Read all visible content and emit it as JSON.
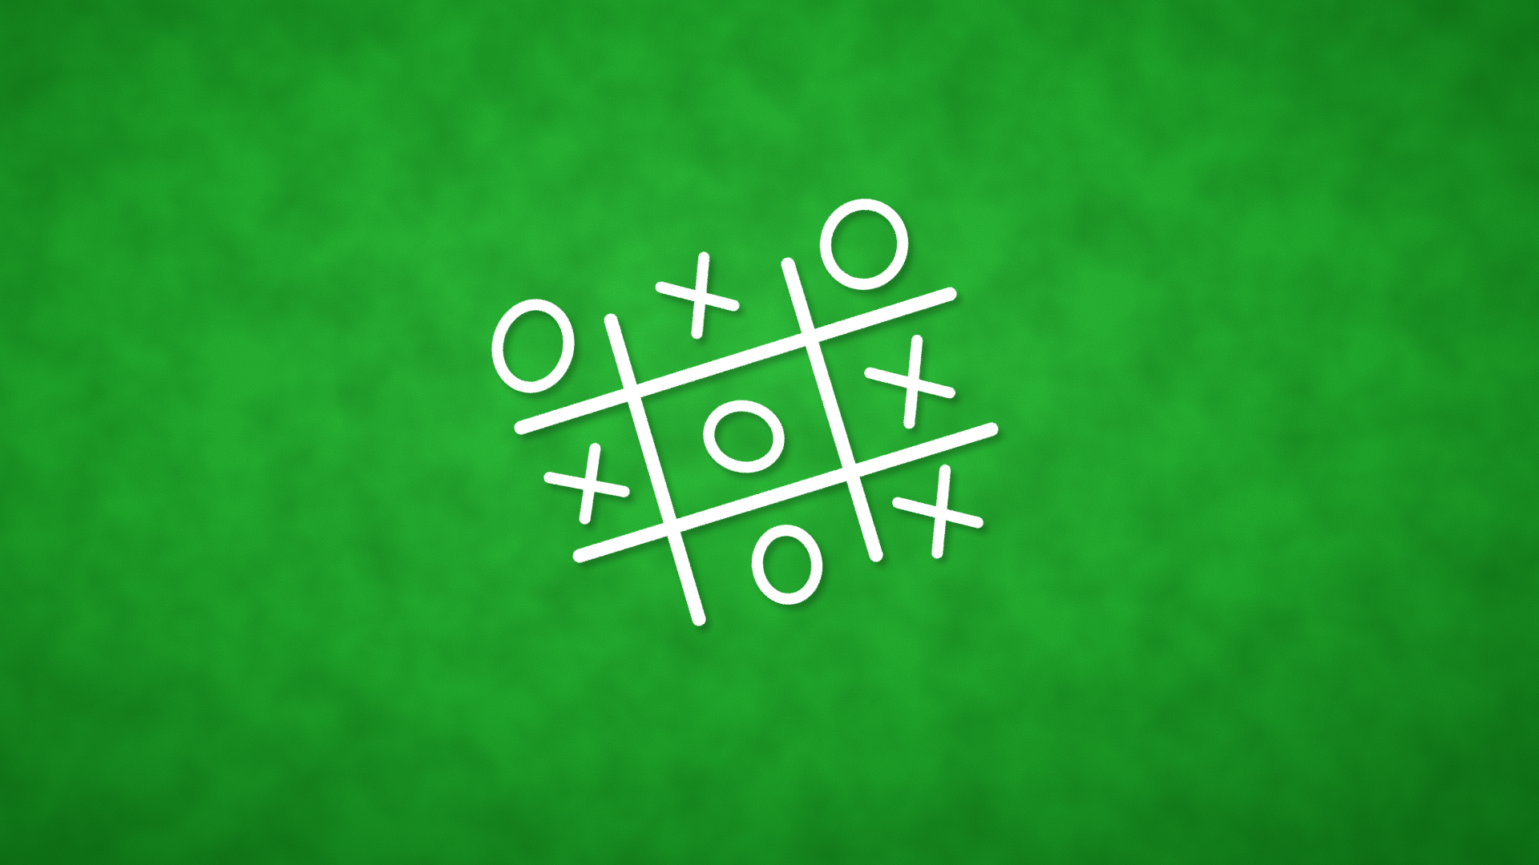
{
  "game": {
    "name": "tic-tac-toe",
    "surface_color": "#2bc93a",
    "surface_edge_color": "#128a1c",
    "chalk_color": "#ffffff",
    "cells": [
      [
        "O",
        "X",
        "O"
      ],
      [
        "X",
        "O",
        "X"
      ],
      [
        "",
        "O",
        "X"
      ]
    ]
  }
}
